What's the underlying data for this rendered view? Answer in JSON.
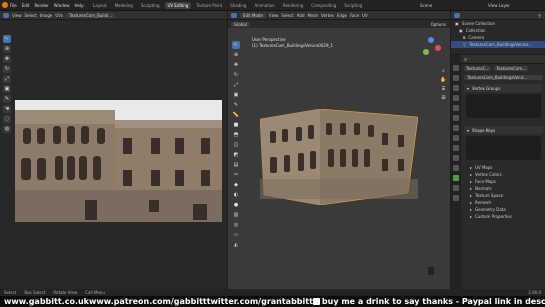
{
  "topbar": {
    "menu": [
      "File",
      "Edit",
      "Render",
      "Window",
      "Help"
    ],
    "workspaces": [
      "Layout",
      "Modeling",
      "Sculpting",
      "UV Editing",
      "Texture Paint",
      "Shading",
      "Animation",
      "Rendering",
      "Compositing",
      "Scripting"
    ],
    "active_workspace": "UV Editing",
    "scene": "Scene",
    "view_layer": "View Layer"
  },
  "uv_editor": {
    "header": {
      "view": "View",
      "select": "Select",
      "image": "Image",
      "uvs": "UVs",
      "image_name": "TexturesCom_Buildi..."
    },
    "bg_color": "#282828"
  },
  "viewport": {
    "header": {
      "mode": "Edit Mode",
      "view": "View",
      "select": "Select",
      "add": "Add",
      "mesh": "Mesh",
      "vertex": "Vertex",
      "edge": "Edge",
      "face": "Face",
      "uv": "UV",
      "orientation": "Global",
      "options": "Options"
    },
    "overlay_title": "User Perspective",
    "overlay_object": "(1) TexturesCom_BuildingsVenice0029_1",
    "bg_color": "#3a3a3a"
  },
  "outliner": {
    "title": "Scene Collection",
    "rows": [
      {
        "label": "Scene Collection"
      },
      {
        "label": "Collection"
      },
      {
        "label": "Camera"
      },
      {
        "label": "TexturesCom_BuildingsVenice..."
      }
    ]
  },
  "properties": {
    "object_field": "TexturesC...",
    "mesh_field": "TexturesCom...",
    "data_name": "TexturesCom_BuildingsVenic...",
    "panels": [
      "Vertex Groups",
      "Shape Keys"
    ],
    "sections": [
      "UV Maps",
      "Vertex Colors",
      "Face Maps",
      "Normals",
      "Texture Space",
      "Remesh",
      "Geometry Data",
      "Custom Properties"
    ]
  },
  "status_bar": {
    "items": [
      "Select",
      "Box Select",
      "Rotate View",
      "Call Menu"
    ],
    "version": "2.90.0"
  },
  "footer": {
    "site": "www.gabbitt.co.uk",
    "patreon": "www.patreon.com/gabbitt",
    "twitter": "twitter.com/grantabbitt",
    "coffee": "buy me a drink to say thanks - Paypal link in description"
  }
}
